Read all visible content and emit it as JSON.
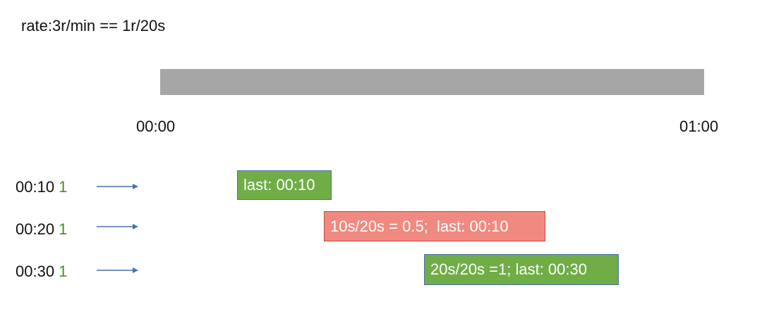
{
  "title": "rate:3r/min == 1r/20s",
  "timeline": {
    "start_label": "00:00",
    "end_label": "01:00",
    "bar_color": "#a6a6a6"
  },
  "requests": [
    {
      "time": "00:10",
      "count": "1",
      "result": "last: 00:10",
      "status": "allowed",
      "box_color": "#70ad47"
    },
    {
      "time": "00:20",
      "count": "1",
      "result": "10s/20s = 0.5;  last: 00:10",
      "status": "rejected",
      "box_color": "#f08a80"
    },
    {
      "time": "00:30",
      "count": "1",
      "result": "20s/20s =1; last: 00:30",
      "status": "allowed",
      "box_color": "#70ad47"
    }
  ],
  "colors": {
    "count_text": "#4e8a2e",
    "arrow": "#4a6fb0"
  }
}
